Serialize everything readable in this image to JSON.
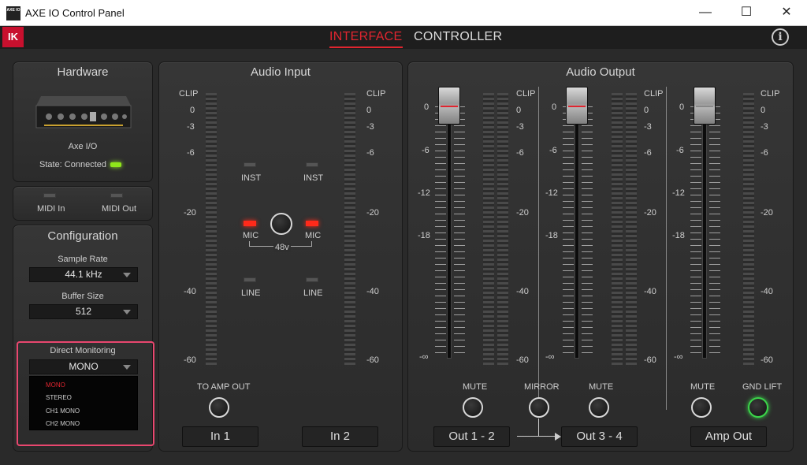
{
  "window": {
    "title": "AXE IO Control Panel",
    "icon_text": "AXE IO",
    "minimize": "—",
    "maximize": "☐",
    "close": "✕"
  },
  "nav": {
    "logo": "IK",
    "tabs": [
      "INTERFACE",
      "CONTROLLER"
    ],
    "info": "i"
  },
  "hardware": {
    "title": "Hardware",
    "device": "Axe I/O",
    "state": "State: Connected"
  },
  "midi": {
    "in": "MIDI In",
    "out": "MIDI Out"
  },
  "configuration": {
    "title": "Configuration",
    "sample_rate_label": "Sample Rate",
    "sample_rate": "44.1 kHz",
    "buffer_size_label": "Buffer Size",
    "buffer_size": "512",
    "direct_monitoring_label": "Direct Monitoring",
    "direct_monitoring": "MONO",
    "options": [
      "MONO",
      "STEREO",
      "CH1 MONO",
      "CH2 MONO"
    ]
  },
  "audio_input": {
    "title": "Audio Input",
    "scale": [
      "CLIP",
      "0",
      "-3",
      "-6",
      "-20",
      "-40",
      "-60"
    ],
    "inst": "INST",
    "mic": "MIC",
    "line": "LINE",
    "phantom": "48v",
    "to_amp_out": "TO AMP OUT",
    "in1": "In 1",
    "in2": "In 2"
  },
  "audio_output": {
    "title": "Audio Output",
    "fader_scale": [
      "0",
      "-6",
      "-12",
      "-18",
      "-∞"
    ],
    "meter_scale": [
      "CLIP",
      "0",
      "-3",
      "-6",
      "-20",
      "-40",
      "-60"
    ],
    "mute": "MUTE",
    "mirror": "MIRROR",
    "gnd_lift": "GND LIFT",
    "out12": "Out 1 - 2",
    "out34": "Out 3 - 4",
    "amp_out": "Amp Out"
  },
  "colors": {
    "accent": "#e0252f",
    "led_green": "#8fe61a",
    "highlight": "#e9476f"
  }
}
